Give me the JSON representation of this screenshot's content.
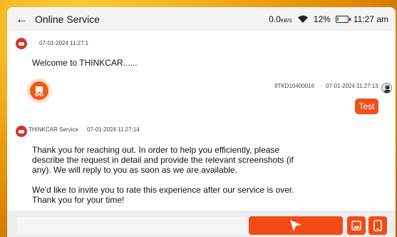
{
  "app": {
    "title": "Online Service",
    "back_icon": "arrow-left-icon"
  },
  "status_bar": {
    "speed": "0.0",
    "speed_unit": "KB/S",
    "battery": "12%",
    "battery_level": 0.12,
    "time": "11:27 am"
  },
  "messages": [
    {
      "id": "m1",
      "sender": "",
      "timestamp": "07-01-2024 11:27:1",
      "text": "Welcome to THINKCAR......"
    },
    {
      "id": "m2",
      "sender": "9TKD10400016",
      "timestamp": "07-01-2024 11:27:13",
      "text": "Test"
    },
    {
      "id": "m3",
      "sender": "THINKCAR Service",
      "timestamp": "07-01-2024 11:27:14",
      "lines": [
        "Thank you for reaching out. In order to help you efficiently, please",
        "describe the request in detail and provide the relevant screenshots (if",
        "any). We will reply to you as soon as we are available.",
        "",
        "We'd like to invite you to rate this experience after our service is over.",
        "Thank you for your time!"
      ]
    }
  ],
  "colors": {
    "accent": "#f24a14",
    "brand_red": "#d9302b",
    "frame": "#ffb200"
  }
}
